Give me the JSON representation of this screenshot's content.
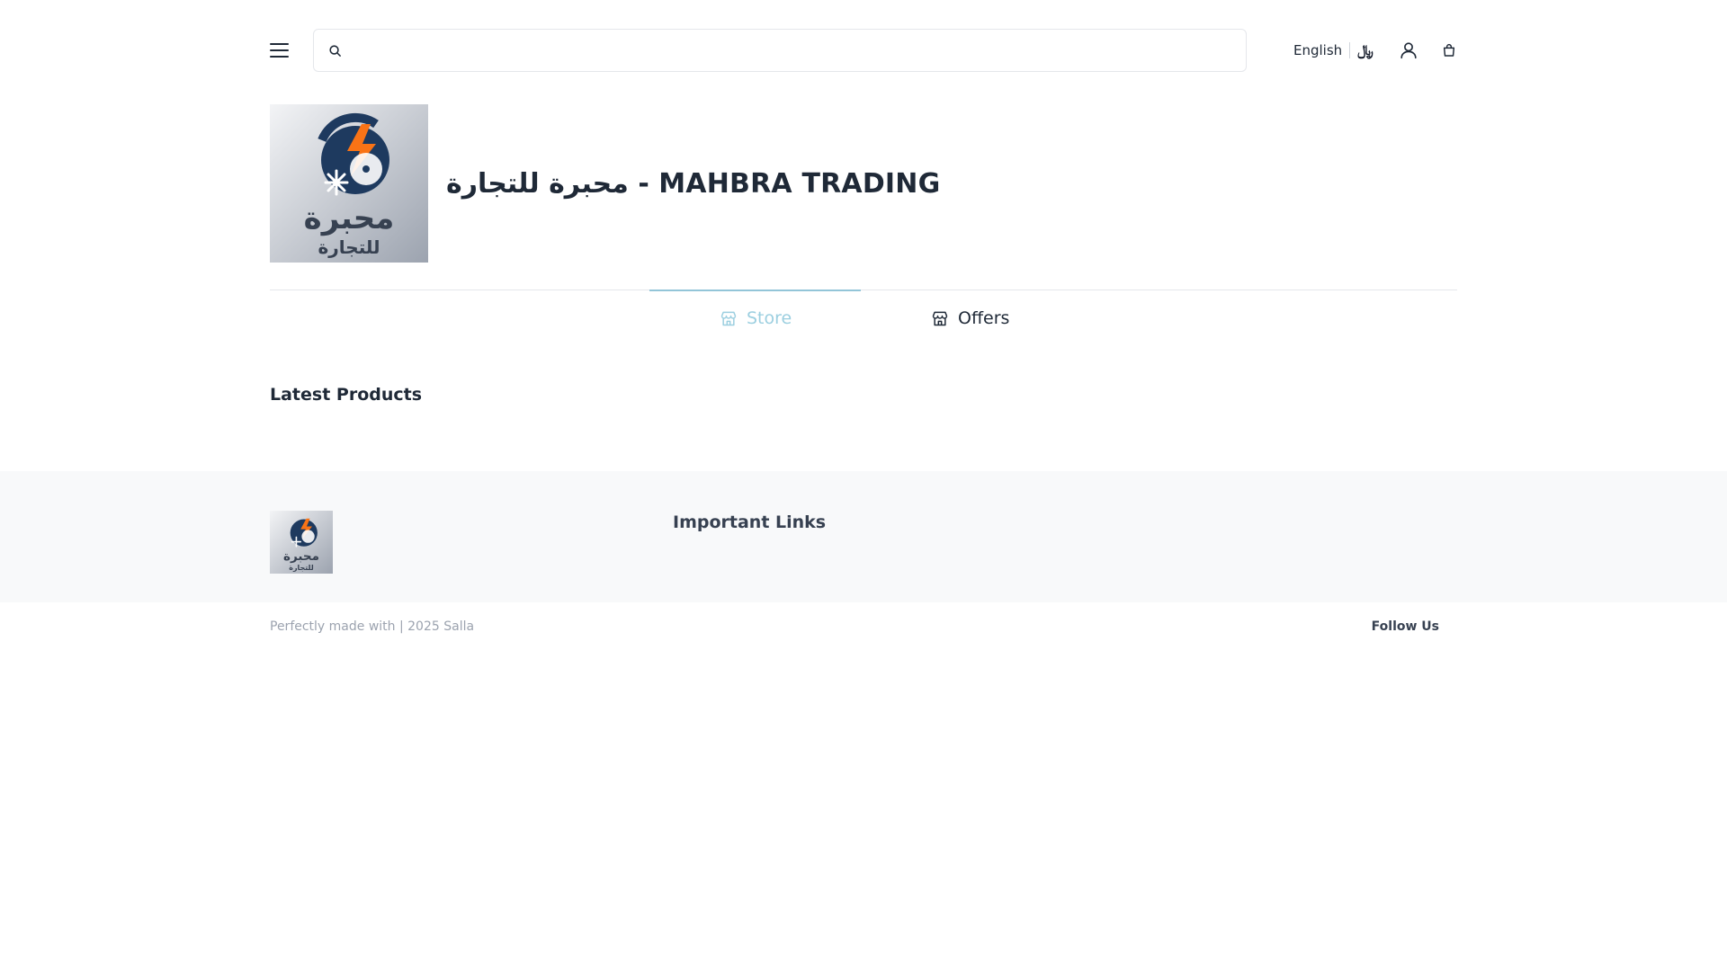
{
  "header": {
    "search": {
      "placeholder": "",
      "value": ""
    },
    "language_label": "English",
    "currency_label": "﷼",
    "icons": {
      "menu": "hamburger-menu-icon",
      "search": "search-icon",
      "account": "user-icon",
      "cart": "shopping-bag-icon"
    }
  },
  "store": {
    "name": "محبرة للتجارة - MAHBRA TRADING",
    "logo_text_line1": "محبرة",
    "logo_text_line2": "للتجارة"
  },
  "tabs": [
    {
      "label": "Store",
      "icon": "store-icon",
      "active": true
    },
    {
      "label": "Offers",
      "icon": "store-icon",
      "active": false
    }
  ],
  "main": {
    "latest_products_title": "Latest Products"
  },
  "footer": {
    "important_links_title": "Important Links",
    "copyright": "Perfectly made with | 2025 Salla",
    "follow_us": "Follow Us"
  },
  "colors": {
    "accent": "#93c5d8",
    "logo_orange": "#f97316",
    "logo_blue": "#1e3a5f"
  }
}
